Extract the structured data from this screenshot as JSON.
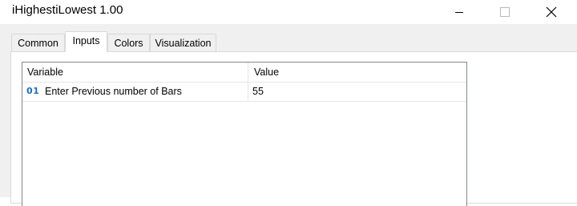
{
  "window": {
    "title": "iHighestiLowest 1.00",
    "controls": {
      "minimize_icon": "minimize-icon",
      "maximize_icon": "maximize-icon",
      "close_icon": "close-icon"
    }
  },
  "tabs": [
    {
      "label": "Common",
      "active": false
    },
    {
      "label": "Inputs",
      "active": true
    },
    {
      "label": "Colors",
      "active": false
    },
    {
      "label": "Visualization",
      "active": false
    }
  ],
  "inputs_table": {
    "columns": [
      "Variable",
      "Value"
    ],
    "rows": [
      {
        "icon_label": "01",
        "variable": "Enter Previous number of Bars",
        "value": "55"
      }
    ]
  },
  "colors": {
    "dialog_background": "#f0f0f0",
    "panel_background": "#ffffff",
    "icon_accent": "#1f6fb2",
    "border": "#828790"
  }
}
